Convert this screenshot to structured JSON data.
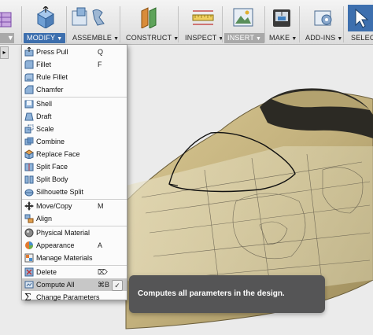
{
  "toolbar": {
    "groups": [
      {
        "label": "MODIFY",
        "icon": "modify-icon",
        "active": true
      },
      {
        "label": "ASSEMBLE",
        "icon": "assemble-icon"
      },
      {
        "label": "CONSTRUCT",
        "icon": "construct-icon"
      },
      {
        "label": "INSPECT",
        "icon": "inspect-icon"
      },
      {
        "label": "INSERT",
        "icon": "insert-icon"
      },
      {
        "label": "MAKE",
        "icon": "make-icon"
      },
      {
        "label": "ADD-INS",
        "icon": "add-ins-icon"
      },
      {
        "label": "SELECT",
        "icon": "select-icon"
      }
    ],
    "arrow": "▼"
  },
  "menu": {
    "items": [
      {
        "label": "Press Pull",
        "shortcut": "Q",
        "icon": "press-pull-icon"
      },
      {
        "label": "Fillet",
        "shortcut": "F",
        "icon": "fillet-icon"
      },
      {
        "label": "Rule Fillet",
        "shortcut": "",
        "icon": "rule-fillet-icon"
      },
      {
        "label": "Chamfer",
        "shortcut": "",
        "icon": "chamfer-icon"
      },
      {
        "label": "Shell",
        "shortcut": "",
        "icon": "shell-icon"
      },
      {
        "label": "Draft",
        "shortcut": "",
        "icon": "draft-icon"
      },
      {
        "label": "Scale",
        "shortcut": "",
        "icon": "scale-icon"
      },
      {
        "label": "Combine",
        "shortcut": "",
        "icon": "combine-icon"
      },
      {
        "label": "Replace Face",
        "shortcut": "",
        "icon": "replace-face-icon"
      },
      {
        "label": "Split Face",
        "shortcut": "",
        "icon": "split-face-icon"
      },
      {
        "label": "Split Body",
        "shortcut": "",
        "icon": "split-body-icon"
      },
      {
        "label": "Silhouette Split",
        "shortcut": "",
        "icon": "silhouette-split-icon"
      },
      {
        "label": "Move/Copy",
        "shortcut": "M",
        "icon": "move-copy-icon"
      },
      {
        "label": "Align",
        "shortcut": "",
        "icon": "align-icon"
      },
      {
        "label": "Physical Material",
        "shortcut": "",
        "icon": "physical-material-icon"
      },
      {
        "label": "Appearance",
        "shortcut": "A",
        "icon": "appearance-icon"
      },
      {
        "label": "Manage Materials",
        "shortcut": "",
        "icon": "manage-materials-icon"
      },
      {
        "label": "Delete",
        "shortcut": "⌦",
        "icon": "delete-icon"
      },
      {
        "label": "Compute All",
        "shortcut": "⌘B",
        "icon": "compute-all-icon",
        "highlighted": true
      },
      {
        "label": "Change Parameters",
        "shortcut": "",
        "icon": "change-parameters-icon"
      }
    ],
    "confirm_glyph": "✓"
  },
  "tooltip": {
    "text": "Computes all parameters in the design."
  },
  "colors": {
    "accent": "#3d6fae",
    "model": "#c2b07c",
    "tooltip_bg": "#555556"
  }
}
